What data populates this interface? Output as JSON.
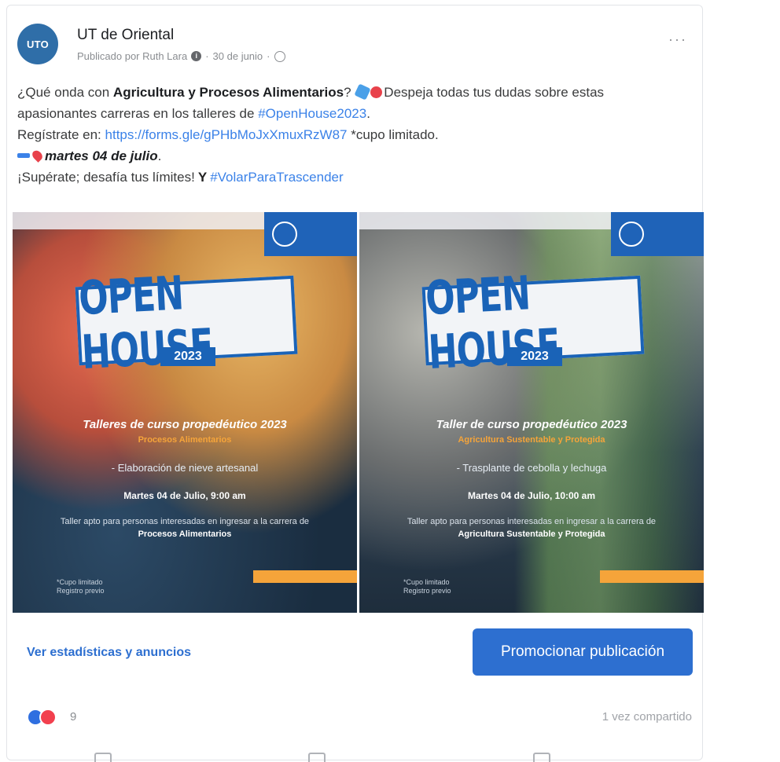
{
  "post": {
    "page_name": "UT de Oriental",
    "avatar_text": "UTO",
    "meta": "Publicado por Ruth Lara",
    "date": "30 de junio",
    "more_label": "···",
    "text": {
      "line1_pre": "¿Qué onda con ",
      "line1_bold": "Agricultura y Procesos Alimentarios",
      "line1_mid": "? ",
      "line1_post": "Despeja todas tus dudas sobre estas",
      "line2_pre": "apasionantes carreras en los talleres de ",
      "line2_hashtag": "#OpenHouse2023",
      "line2_post": ".",
      "line3_pre": "Regístrate en: ",
      "line3_link": "https://forms.gle/gPHbMoJxXmuxRzW87",
      "line3_post": " *cupo limitado.",
      "line4_bold": "martes 04 de julio",
      "line4_post": ".",
      "line5_pre": "¡Supérate; desafía tus límites!",
      "line5_hashtag": "#VolarParaTrascender"
    }
  },
  "posters": [
    {
      "open_house": "OPEN HOUSE",
      "year": "2023",
      "title": "Talleres de curso propedéutico 2023",
      "subtitle": "Procesos Alimentarios",
      "item": "- Elaboración de nieve artesanal",
      "date": "Martes 04 de Julio, 9:00 am",
      "desc_pre": "Taller apto para personas interesadas en ingresar a la carrera de ",
      "desc_bold": "Procesos Alimentarios",
      "note": "*Cupo limitado\nRegistro previo"
    },
    {
      "open_house": "OPEN HOUSE",
      "year": "2023",
      "title": "Taller de curso propedéutico 2023",
      "subtitle": "Agricultura Sustentable y Protegida",
      "item": "- Trasplante de cebolla y lechuga",
      "date": "Martes 04 de Julio, 10:00 am",
      "desc_pre": "Taller apto para personas interesadas en ingresar a la carrera de ",
      "desc_bold": "Agricultura Sustentable y Protegida",
      "note": "*Cupo limitado\nRegistro previo"
    }
  ],
  "actions": {
    "stats_link": "Ver estadísticas y anuncios",
    "promote_button": "Promocionar publicación"
  },
  "reactions": {
    "count": "9",
    "shares": "1 vez compartido"
  },
  "colors": {
    "accent": "#2d6fd0",
    "brand_blue": "#1a63b7",
    "orange": "#f5a43a"
  }
}
